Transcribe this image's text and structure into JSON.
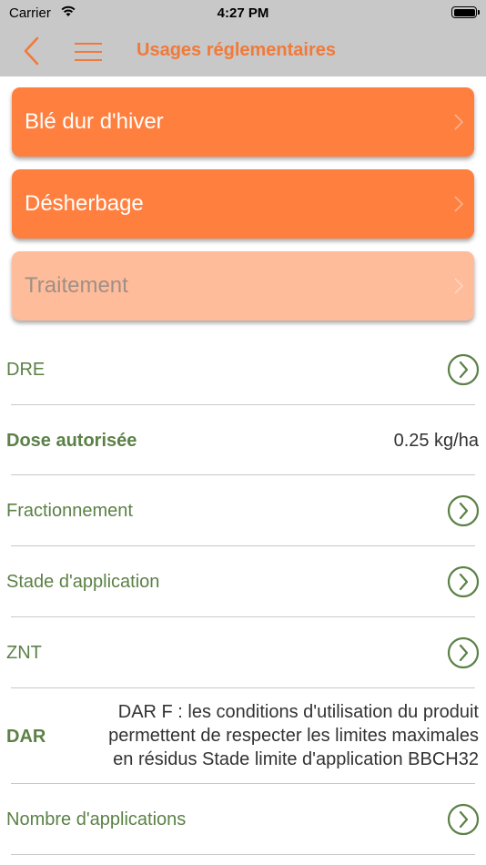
{
  "status_bar": {
    "carrier": "Carrier",
    "time": "4:27 PM"
  },
  "nav": {
    "title": "Usages réglementaires",
    "back_icon": "chevron-left-icon",
    "menu_icon": "hamburger-menu-icon"
  },
  "colors": {
    "accent": "#f07a3a",
    "card_active": "#ff7f3f",
    "card_disabled": "#ffbc9b",
    "green": "#5b8146",
    "bar": "#c8c8c8"
  },
  "cards": [
    {
      "label": "Blé dur d'hiver",
      "active": true
    },
    {
      "label": "Désherbage",
      "active": true
    },
    {
      "label": "Traitement",
      "active": false
    }
  ],
  "rows": {
    "dre": {
      "label": "DRE"
    },
    "dose": {
      "label": "Dose autorisée",
      "value": "0.25 kg/ha"
    },
    "fractionnement": {
      "label": "Fractionnement"
    },
    "stade": {
      "label": "Stade d'application"
    },
    "znt": {
      "label": "ZNT"
    },
    "dar": {
      "label": "DAR",
      "lines": [
        "DAR F : les conditions d'utilisation du produit",
        "permettent de respecter les limites maximales",
        "en résidus Stade limite d'application BBCH32"
      ]
    },
    "nombre": {
      "label": "Nombre d'applications"
    }
  }
}
